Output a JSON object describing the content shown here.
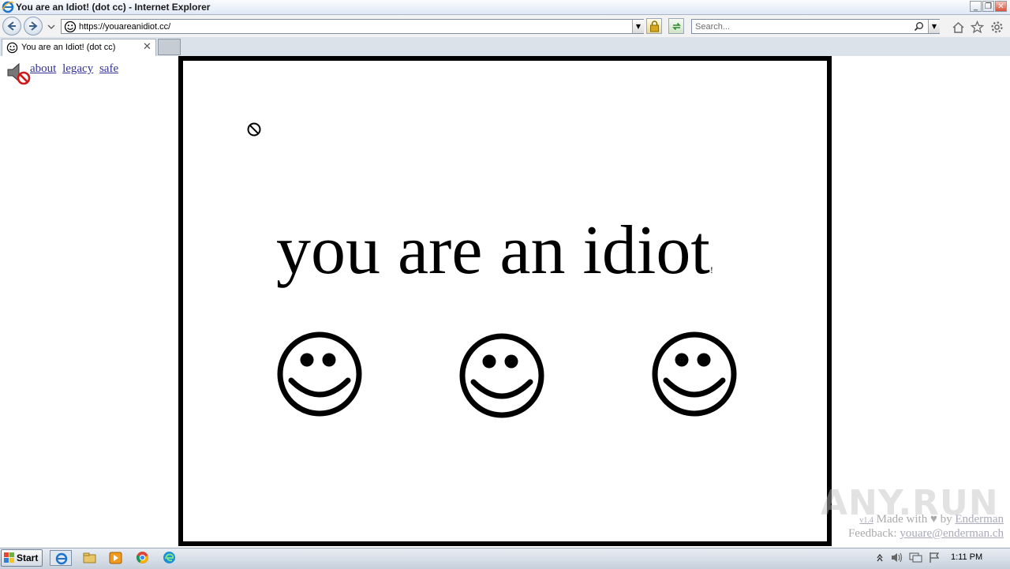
{
  "window": {
    "title": "You are an Idiot! (dot cc) - Internet Explorer",
    "controls": {
      "minimize": "_",
      "maximize": "❐",
      "close": "✕"
    }
  },
  "nav": {
    "url": "https://youareanidiot.cc/",
    "search_placeholder": "Search..."
  },
  "tabs": [
    {
      "label": "You are an Idiot! (dot cc)",
      "close": "✕"
    }
  ],
  "page": {
    "links": [
      "about",
      "legacy",
      "safe"
    ],
    "headline": "you are an idiot",
    "headline_suffix": "!",
    "footer": {
      "version": "v1.4",
      "made_with": "Made with",
      "heart": "♥",
      "by": "by",
      "author": "Enderman",
      "feedback_label": "Feedback:",
      "feedback_email": "youare@enderman.ch"
    }
  },
  "watermark": "ANY.RUN",
  "taskbar": {
    "start": "Start",
    "clock": "1:11 PM"
  },
  "colors": {
    "link": "#333399",
    "frame": "#000000"
  }
}
